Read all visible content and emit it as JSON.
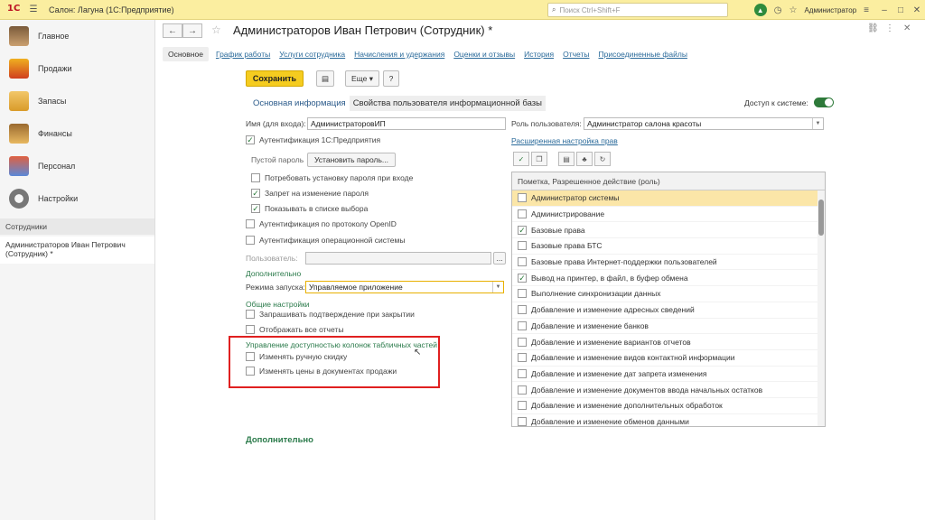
{
  "topbar": {
    "logo": "1С",
    "app_title": "Салон: Лагуна  (1С:Предприятие)",
    "search_placeholder": "Поиск Ctrl+Shift+F",
    "user": "Администратор"
  },
  "sidebar": {
    "items": [
      {
        "label": "Главное"
      },
      {
        "label": "Продажи"
      },
      {
        "label": "Запасы"
      },
      {
        "label": "Финансы"
      },
      {
        "label": "Персонал"
      },
      {
        "label": "Настройки"
      }
    ],
    "section": "Сотрудники",
    "open_doc": "Администраторов Иван Петрович (Сотрудник) *"
  },
  "doc": {
    "title": "Администраторов Иван Петрович (Сотрудник) *",
    "tabs": [
      "Основное",
      "График работы",
      "Услуги сотрудника",
      "Начисления и удержания",
      "Оценки и отзывы",
      "История",
      "Отчеты",
      "Присоединенные файлы"
    ]
  },
  "toolbar": {
    "save": "Сохранить",
    "more": "Еще",
    "help": "?"
  },
  "subtabs": [
    "Основная информация",
    "Свойства пользователя информационной базы"
  ],
  "access": {
    "label": "Доступ к системе:",
    "on": true
  },
  "form": {
    "login_label": "Имя (для входа):",
    "login_value": "АдминистраторовИП",
    "role_label": "Роль пользователя:",
    "role_value": "Администратор салона красоты",
    "auth1c": "Аутентификация 1С:Предприятия",
    "empty_password": "Пустой пароль",
    "set_password": "Установить пароль...",
    "require_change": "Потребовать установку пароля при входе",
    "forbid_change": "Запрет на изменение пароля",
    "show_in_list": "Показывать в списке выбора",
    "openid": "Аутентификация по протоколу OpenID",
    "os_auth": "Аутентификация операционной системы",
    "user_label": "Пользователь:",
    "user_btn": "...",
    "extra_title": "Дополнительно",
    "launch_label": "Режима запуска:",
    "launch_value": "Управляемое приложение",
    "general_title": "Общие настройки",
    "confirm_close": "Запрашивать подтверждение при закрытии",
    "show_reports": "Отображать все отчеты",
    "columns_title": "Управление доступностью колонок табличных частей",
    "manual_discount": "Изменять ручную скидку",
    "change_prices": "Изменять цены в документах продажи",
    "rights_link": "Расширенная настройка прав",
    "bottom_extra": "Дополнительно"
  },
  "rights": {
    "header": "Пометка, Разрешенное действие (роль)",
    "items": [
      {
        "label": "Администратор системы",
        "checked": false,
        "selected": true
      },
      {
        "label": "Администрирование",
        "checked": false
      },
      {
        "label": "Базовые права",
        "checked": true
      },
      {
        "label": "Базовые права БТС",
        "checked": false
      },
      {
        "label": "Базовые права Интернет-поддержки пользователей",
        "checked": false
      },
      {
        "label": "Вывод на принтер, в файл, в буфер обмена",
        "checked": true
      },
      {
        "label": "Выполнение синхронизации данных",
        "checked": false
      },
      {
        "label": "Добавление и изменение адресных сведений",
        "checked": false
      },
      {
        "label": "Добавление и изменение банков",
        "checked": false
      },
      {
        "label": "Добавление и изменение вариантов отчетов",
        "checked": false
      },
      {
        "label": "Добавление и изменение видов контактной информации",
        "checked": false
      },
      {
        "label": "Добавление и изменение дат запрета изменения",
        "checked": false
      },
      {
        "label": "Добавление и изменение документов ввода начальных остатков",
        "checked": false
      },
      {
        "label": "Добавление и изменение дополнительных обработок",
        "checked": false
      },
      {
        "label": "Добавление и изменение обменов данными",
        "checked": false
      }
    ]
  }
}
